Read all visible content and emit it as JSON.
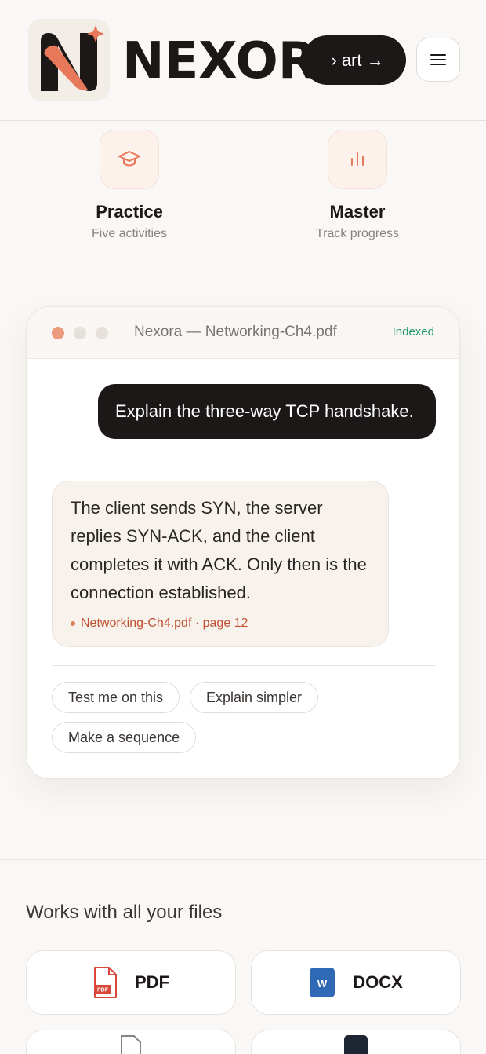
{
  "header": {
    "brand": "NEXOR",
    "cta_label": "› art →",
    "menu_icon": "hamburger-icon"
  },
  "features": [
    {
      "title": "Practice",
      "subtitle": "Five activities",
      "icon": "graduation-cap-icon"
    },
    {
      "title": "Master",
      "subtitle": "Track progress",
      "icon": "bar-chart-icon"
    }
  ],
  "chat": {
    "window_title": "Nexora — Networking-Ch4.pdf",
    "status": "Indexed",
    "user_message": "Explain the three-way TCP handshake.",
    "bot_message": "The client sends SYN, the server replies SYN-ACK, and the client completes it with ACK. Only then is the connection established.",
    "citation": "Networking-Ch4.pdf · page 12",
    "chips": [
      "Test me on this",
      "Explain simpler",
      "Make a sequence"
    ]
  },
  "files": {
    "title": "Works with all your files",
    "types": [
      {
        "label": "PDF",
        "icon": "pdf-file-icon",
        "badge": "PDF"
      },
      {
        "label": "DOCX",
        "icon": "word-doc-icon",
        "badge": "W"
      }
    ]
  },
  "colors": {
    "accent": "#e8785a",
    "dark": "#1b1817",
    "status_green": "#1f9a6a",
    "citation_red": "#c14f2f"
  }
}
